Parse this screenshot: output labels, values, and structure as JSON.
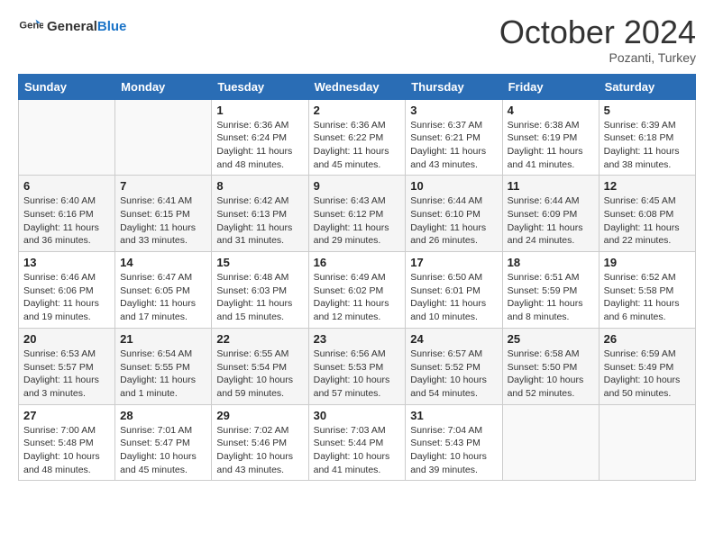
{
  "header": {
    "logo_general": "General",
    "logo_blue": "Blue",
    "month_title": "October 2024",
    "location": "Pozanti, Turkey"
  },
  "days_of_week": [
    "Sunday",
    "Monday",
    "Tuesday",
    "Wednesday",
    "Thursday",
    "Friday",
    "Saturday"
  ],
  "weeks": [
    [
      {
        "day": "",
        "text": ""
      },
      {
        "day": "",
        "text": ""
      },
      {
        "day": "1",
        "sunrise": "6:36 AM",
        "sunset": "6:24 PM",
        "daylight": "11 hours and 48 minutes."
      },
      {
        "day": "2",
        "sunrise": "6:36 AM",
        "sunset": "6:22 PM",
        "daylight": "11 hours and 45 minutes."
      },
      {
        "day": "3",
        "sunrise": "6:37 AM",
        "sunset": "6:21 PM",
        "daylight": "11 hours and 43 minutes."
      },
      {
        "day": "4",
        "sunrise": "6:38 AM",
        "sunset": "6:19 PM",
        "daylight": "11 hours and 41 minutes."
      },
      {
        "day": "5",
        "sunrise": "6:39 AM",
        "sunset": "6:18 PM",
        "daylight": "11 hours and 38 minutes."
      }
    ],
    [
      {
        "day": "6",
        "sunrise": "6:40 AM",
        "sunset": "6:16 PM",
        "daylight": "11 hours and 36 minutes."
      },
      {
        "day": "7",
        "sunrise": "6:41 AM",
        "sunset": "6:15 PM",
        "daylight": "11 hours and 33 minutes."
      },
      {
        "day": "8",
        "sunrise": "6:42 AM",
        "sunset": "6:13 PM",
        "daylight": "11 hours and 31 minutes."
      },
      {
        "day": "9",
        "sunrise": "6:43 AM",
        "sunset": "6:12 PM",
        "daylight": "11 hours and 29 minutes."
      },
      {
        "day": "10",
        "sunrise": "6:44 AM",
        "sunset": "6:10 PM",
        "daylight": "11 hours and 26 minutes."
      },
      {
        "day": "11",
        "sunrise": "6:44 AM",
        "sunset": "6:09 PM",
        "daylight": "11 hours and 24 minutes."
      },
      {
        "day": "12",
        "sunrise": "6:45 AM",
        "sunset": "6:08 PM",
        "daylight": "11 hours and 22 minutes."
      }
    ],
    [
      {
        "day": "13",
        "sunrise": "6:46 AM",
        "sunset": "6:06 PM",
        "daylight": "11 hours and 19 minutes."
      },
      {
        "day": "14",
        "sunrise": "6:47 AM",
        "sunset": "6:05 PM",
        "daylight": "11 hours and 17 minutes."
      },
      {
        "day": "15",
        "sunrise": "6:48 AM",
        "sunset": "6:03 PM",
        "daylight": "11 hours and 15 minutes."
      },
      {
        "day": "16",
        "sunrise": "6:49 AM",
        "sunset": "6:02 PM",
        "daylight": "11 hours and 12 minutes."
      },
      {
        "day": "17",
        "sunrise": "6:50 AM",
        "sunset": "6:01 PM",
        "daylight": "11 hours and 10 minutes."
      },
      {
        "day": "18",
        "sunrise": "6:51 AM",
        "sunset": "5:59 PM",
        "daylight": "11 hours and 8 minutes."
      },
      {
        "day": "19",
        "sunrise": "6:52 AM",
        "sunset": "5:58 PM",
        "daylight": "11 hours and 6 minutes."
      }
    ],
    [
      {
        "day": "20",
        "sunrise": "6:53 AM",
        "sunset": "5:57 PM",
        "daylight": "11 hours and 3 minutes."
      },
      {
        "day": "21",
        "sunrise": "6:54 AM",
        "sunset": "5:55 PM",
        "daylight": "11 hours and 1 minute."
      },
      {
        "day": "22",
        "sunrise": "6:55 AM",
        "sunset": "5:54 PM",
        "daylight": "10 hours and 59 minutes."
      },
      {
        "day": "23",
        "sunrise": "6:56 AM",
        "sunset": "5:53 PM",
        "daylight": "10 hours and 57 minutes."
      },
      {
        "day": "24",
        "sunrise": "6:57 AM",
        "sunset": "5:52 PM",
        "daylight": "10 hours and 54 minutes."
      },
      {
        "day": "25",
        "sunrise": "6:58 AM",
        "sunset": "5:50 PM",
        "daylight": "10 hours and 52 minutes."
      },
      {
        "day": "26",
        "sunrise": "6:59 AM",
        "sunset": "5:49 PM",
        "daylight": "10 hours and 50 minutes."
      }
    ],
    [
      {
        "day": "27",
        "sunrise": "7:00 AM",
        "sunset": "5:48 PM",
        "daylight": "10 hours and 48 minutes."
      },
      {
        "day": "28",
        "sunrise": "7:01 AM",
        "sunset": "5:47 PM",
        "daylight": "10 hours and 45 minutes."
      },
      {
        "day": "29",
        "sunrise": "7:02 AM",
        "sunset": "5:46 PM",
        "daylight": "10 hours and 43 minutes."
      },
      {
        "day": "30",
        "sunrise": "7:03 AM",
        "sunset": "5:44 PM",
        "daylight": "10 hours and 41 minutes."
      },
      {
        "day": "31",
        "sunrise": "7:04 AM",
        "sunset": "5:43 PM",
        "daylight": "10 hours and 39 minutes."
      },
      {
        "day": "",
        "text": ""
      },
      {
        "day": "",
        "text": ""
      }
    ]
  ]
}
